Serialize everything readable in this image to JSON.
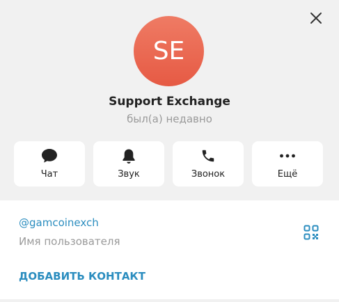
{
  "profile": {
    "avatar_initials": "SE",
    "avatar_color": "#e8644d",
    "name": "Support Exchange",
    "status": "был(а) недавно"
  },
  "actions": [
    {
      "label": "Чат",
      "icon": "chat-bubble-icon"
    },
    {
      "label": "Звук",
      "icon": "bell-icon"
    },
    {
      "label": "Звонок",
      "icon": "phone-icon"
    },
    {
      "label": "Ещё",
      "icon": "more-dots-icon"
    }
  ],
  "info": {
    "username": "@gamcoinexch",
    "username_caption": "Имя пользователя",
    "add_contact_label": "ДОБАВИТЬ КОНТАКТ",
    "qr_icon": "qr-code-icon"
  },
  "colors": {
    "accent": "#2b8dbf",
    "panel_bg": "#f1f1f1",
    "card_bg": "#ffffff"
  },
  "window": {
    "close_icon": "close-icon"
  }
}
